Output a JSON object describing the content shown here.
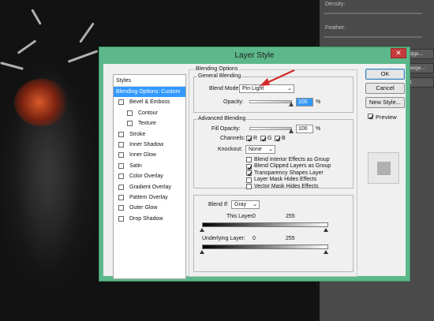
{
  "background_panel": {
    "density_label": "Density:",
    "feather_label": "Feather:",
    "refine_edge_label": "...k Edge...",
    "color_range_label": "...r Range...",
    "invert_label": "Invert"
  },
  "dialog": {
    "title": "Layer Style",
    "close_glyph": "✕"
  },
  "styles_panel": {
    "header": "Styles",
    "items": [
      {
        "label": "Blending Options: Custom",
        "selected": true,
        "checkbox": false,
        "sub": false
      },
      {
        "label": "Bevel & Emboss",
        "selected": false,
        "checkbox": true,
        "sub": false
      },
      {
        "label": "Contour",
        "selected": false,
        "checkbox": true,
        "sub": true
      },
      {
        "label": "Texture",
        "selected": false,
        "checkbox": true,
        "sub": true
      },
      {
        "label": "Stroke",
        "selected": false,
        "checkbox": true,
        "sub": false
      },
      {
        "label": "Inner Shadow",
        "selected": false,
        "checkbox": true,
        "sub": false
      },
      {
        "label": "Inner Glow",
        "selected": false,
        "checkbox": true,
        "sub": false
      },
      {
        "label": "Satin",
        "selected": false,
        "checkbox": true,
        "sub": false
      },
      {
        "label": "Color Overlay",
        "selected": false,
        "checkbox": true,
        "sub": false
      },
      {
        "label": "Gradient Overlay",
        "selected": false,
        "checkbox": true,
        "sub": false
      },
      {
        "label": "Pattern Overlay",
        "selected": false,
        "checkbox": true,
        "sub": false
      },
      {
        "label": "Outer Glow",
        "selected": false,
        "checkbox": true,
        "sub": false
      },
      {
        "label": "Drop Shadow",
        "selected": false,
        "checkbox": true,
        "sub": false
      }
    ]
  },
  "blending_options": {
    "group_title": "Blending Options",
    "general": {
      "title": "General Blending",
      "blend_mode_label": "Blend Mode:",
      "blend_mode_value": "Pin Light",
      "opacity_label": "Opacity:",
      "opacity_value": "100",
      "opacity_unit": "%"
    },
    "advanced": {
      "title": "Advanced Blending",
      "fill_opacity_label": "Fill Opacity:",
      "fill_opacity_value": "100",
      "fill_opacity_unit": "%",
      "channels_label": "Channels:",
      "channel_r": "R",
      "channel_g": "G",
      "channel_b": "B",
      "knockout_label": "Knockout:",
      "knockout_value": "None",
      "options": [
        {
          "label": "Blend Interior Effects as Group",
          "checked": false
        },
        {
          "label": "Blend Clipped Layers as Group",
          "checked": true
        },
        {
          "label": "Transparency Shapes Layer",
          "checked": true
        },
        {
          "label": "Layer Mask Hides Effects",
          "checked": false
        },
        {
          "label": "Vector Mask Hides Effects",
          "checked": false
        }
      ]
    },
    "blend_if": {
      "label": "Blend If:",
      "value": "Gray",
      "this_layer_label": "This Layer:",
      "this_layer_min": "0",
      "this_layer_max": "255",
      "underlying_label": "Underlying Layer:",
      "underlying_min": "0",
      "underlying_max": "255"
    }
  },
  "buttons": {
    "ok": "OK",
    "cancel": "Cancel",
    "new_style": "New Style...",
    "preview_label": "Preview"
  },
  "colors": {
    "dialog_frame": "#5cb88a",
    "selection": "#3399ff",
    "arrow": "#d42a2a",
    "close_button": "#c53a3a"
  }
}
